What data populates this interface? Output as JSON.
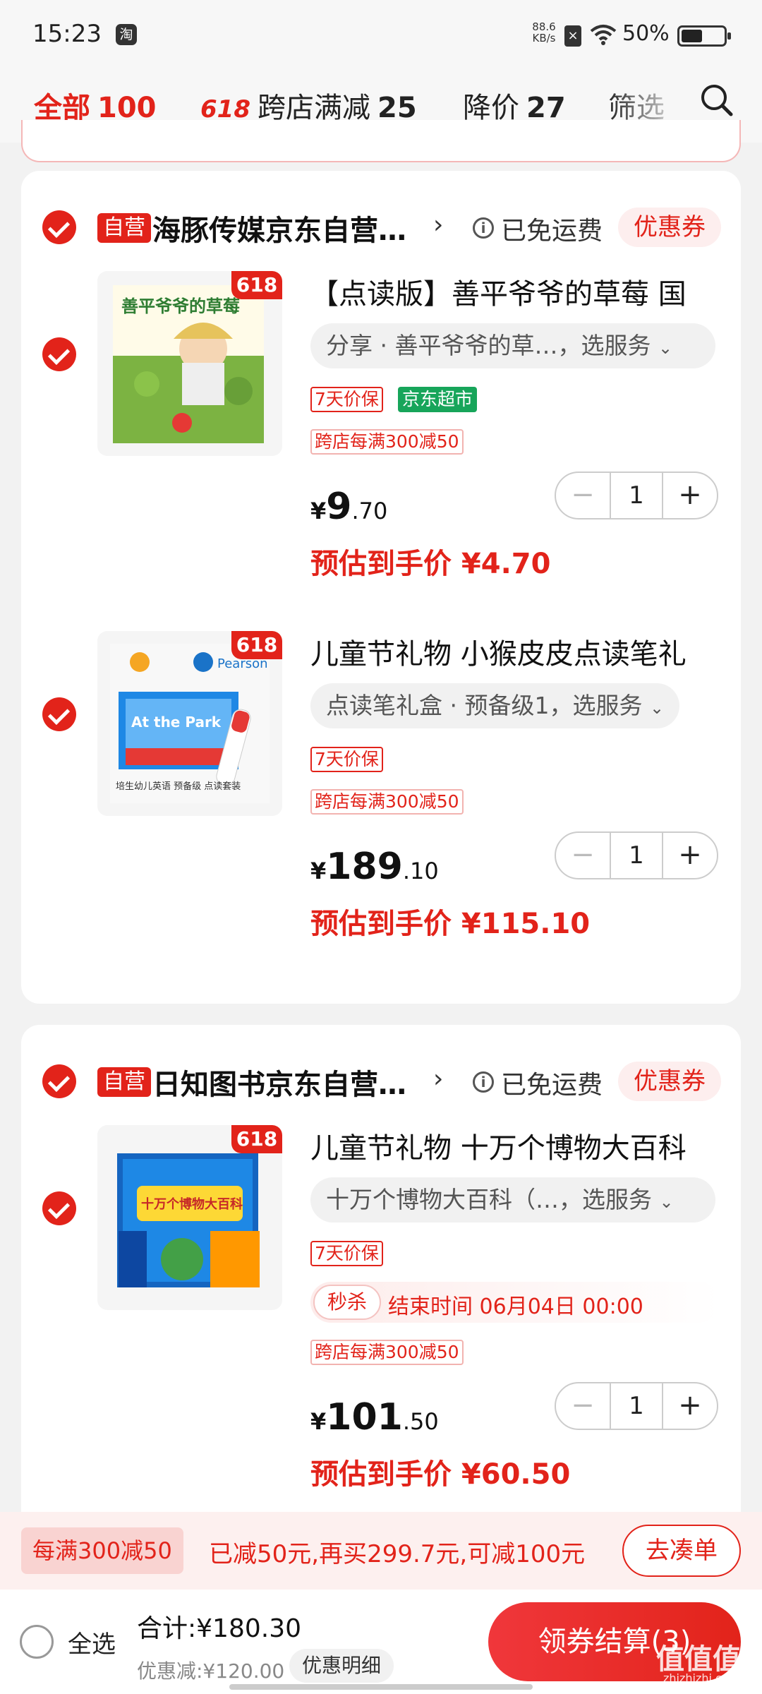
{
  "status_bar": {
    "time": "15:23",
    "app_icon": "淘",
    "net_speed_value": "88.6",
    "net_speed_unit": "KB/s",
    "battery_text": "50%",
    "battery_level": 0.5
  },
  "tabs": [
    {
      "label": "全部",
      "count": "100"
    },
    {
      "badge": "618",
      "label": "跨店满减",
      "count": "25"
    },
    {
      "label": "降价",
      "count": "27"
    },
    {
      "label": "筛选"
    }
  ],
  "shops": [
    {
      "self_badge": "自营",
      "name": "海豚传媒京东自营…",
      "shipping": "已免运费",
      "coupon": "优惠券",
      "products": [
        {
          "badge": "618",
          "image_title": "善平爷爷的草莓",
          "title": "【点读版】善平爷爷的草莓 国",
          "spec": "分享 · 善平爷爷的草…，选服务",
          "tags": [
            "7天价保",
            "京东超市"
          ],
          "promo": "跨店每满300减50",
          "currency": "¥",
          "price_int": "9",
          "price_dec": ".70",
          "est_label": "预估到手价 ¥4.70",
          "qty": "1"
        },
        {
          "badge": "618",
          "image_title": "At the Park",
          "image_brand": "Pearson",
          "image_caption": "培生幼儿英语 预备级 点读套装",
          "title": "儿童节礼物 小猴皮皮点读笔礼",
          "spec": "点读笔礼盒 · 预备级1，选服务",
          "tags": [
            "7天价保"
          ],
          "promo": "跨店每满300减50",
          "currency": "¥",
          "price_int": "189",
          "price_dec": ".10",
          "est_label": "预估到手价 ¥115.10",
          "qty": "1"
        }
      ]
    },
    {
      "self_badge": "自营",
      "name": "日知图书京东自营…",
      "shipping": "已免运费",
      "coupon": "优惠券",
      "products": [
        {
          "badge": "618",
          "image_title": "十万个博物大百科",
          "title": "儿童节礼物 十万个博物大百科",
          "spec": "十万个博物大百科（…，选服务",
          "tags": [
            "7天价保"
          ],
          "flash_label": "秒杀",
          "flash_time": "结束时间 06月04日 00:00",
          "promo": "跨店每满300减50",
          "currency": "¥",
          "price_int": "101",
          "price_dec": ".50",
          "est_label": "预估到手价 ¥60.50",
          "qty": "1"
        }
      ]
    }
  ],
  "promo_bar": {
    "tag": "每满300减50",
    "text": "已减50元,再买299.7元,可减100元",
    "button": "去凑单"
  },
  "checkout": {
    "select_all": "全选",
    "total": "合计:¥180.30",
    "discount": "优惠减:¥120.00",
    "detail_button": "优惠明细",
    "pay_button": "领券结算(3)"
  },
  "watermark": {
    "text": "值值值",
    "sub": "zhizhizhi.com"
  },
  "colors": {
    "accent": "#e2231a",
    "green_tag": "#17a55a"
  }
}
